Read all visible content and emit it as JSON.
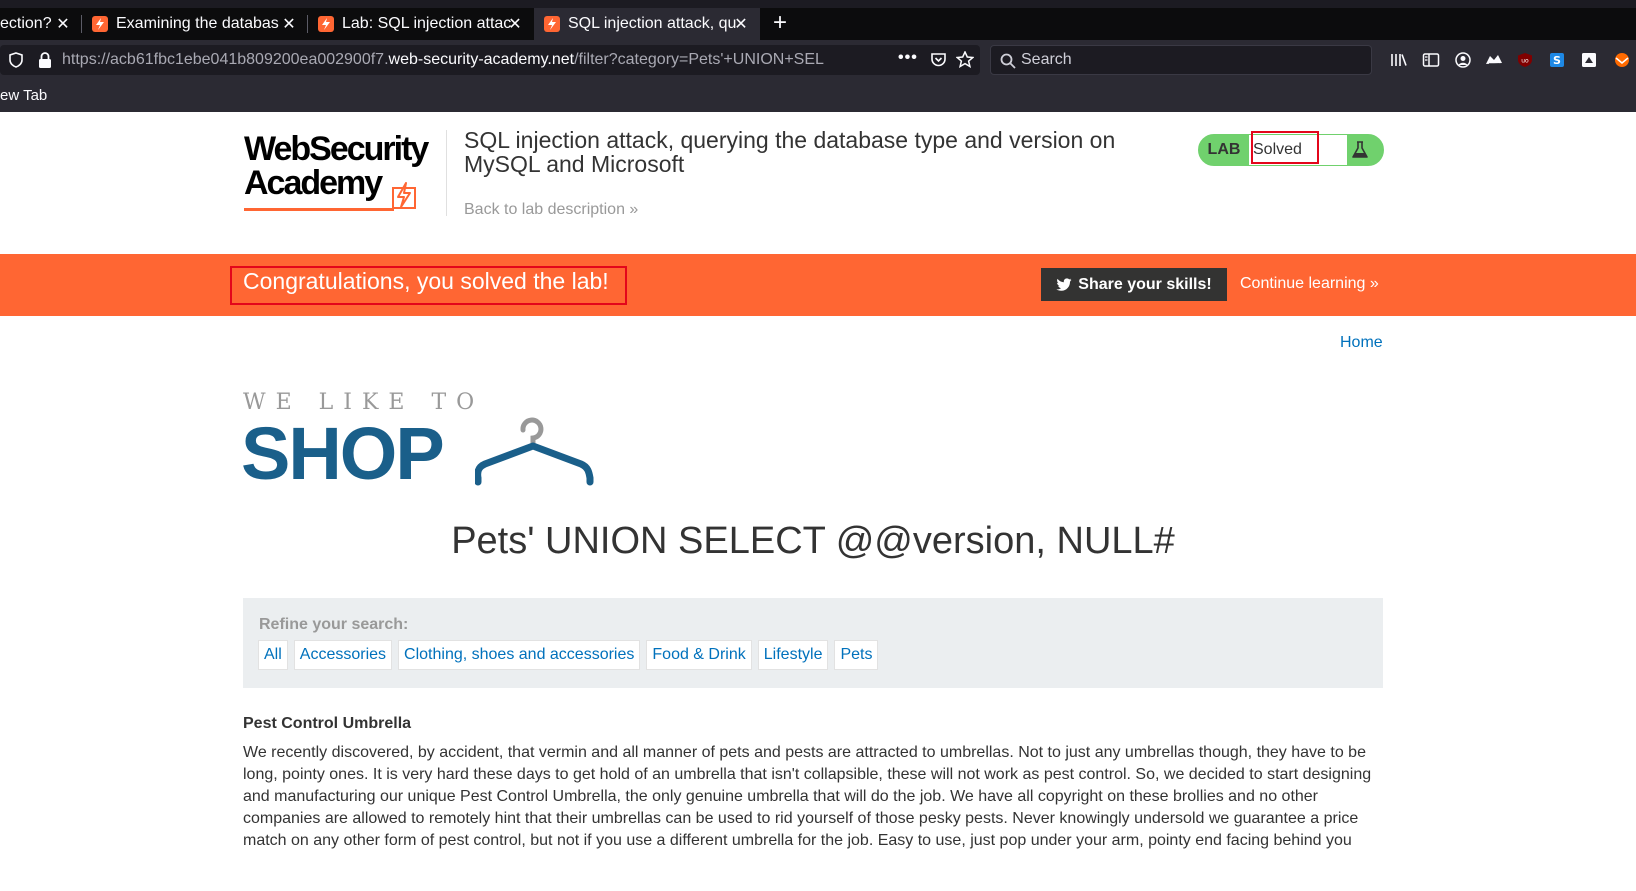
{
  "browser": {
    "tabs": [
      {
        "title": "ection?",
        "active": false
      },
      {
        "title": "Examining the databas",
        "active": false
      },
      {
        "title": "Lab: SQL injection attac",
        "active": false
      },
      {
        "title": "SQL injection attack, qu",
        "active": true
      }
    ],
    "url_prefix": "https://acb61fbc1ebe041b809200ea002900f7.",
    "url_domain": "web-security-academy.net",
    "url_path": "/filter?category=Pets'+UNION+SEL",
    "search_placeholder": "Search",
    "bookmark_label": "ew Tab",
    "colors": {
      "tab_bar": "#0c0c0d",
      "toolbar": "#2b2a33"
    }
  },
  "lab_header": {
    "logo_line1": "WebSecurity",
    "logo_line2": "Academy",
    "title": "SQL injection attack, querying the database type and version on MySQL and Microsoft",
    "back_link": "Back to lab description »",
    "status_tag": "LAB",
    "status_value": "Solved"
  },
  "banner": {
    "message": "Congratulations, you solved the lab!",
    "share_button": "Share your skills!",
    "continue_link": "Continue learning »",
    "color": "#ff6633"
  },
  "shop": {
    "home_link": "Home",
    "logo_tagline": "WE LIKE TO",
    "logo_word": "SHOP",
    "heading": "Pets' UNION SELECT @@version, NULL#",
    "refine_label": "Refine your search:",
    "filters": [
      "All",
      "Accessories",
      "Clothing, shoes and accessories",
      "Food & Drink",
      "Lifestyle",
      "Pets"
    ],
    "product_name": "Pest Control Umbrella",
    "product_description": "We recently discovered, by accident, that vermin and all manner of pets and pests are attracted to umbrellas. Not to just any umbrellas though, they have to be long, pointy ones. It is very hard these days to get hold of an umbrella that isn't collapsible, these will not work as pest control. So, we decided to start designing and manufacturing our unique Pest Control Umbrella, the only genuine umbrella that will do the job. We have all copyright on these brollies and no other companies are allowed to remotely hint that their umbrellas can be used to rid yourself of those pesky pests. Never knowingly undersold we guarantee a price match on any other form of pest control, but not if you use a different umbrella for the job. Easy to use, just pop under your arm, pointy end facing behind you"
  }
}
